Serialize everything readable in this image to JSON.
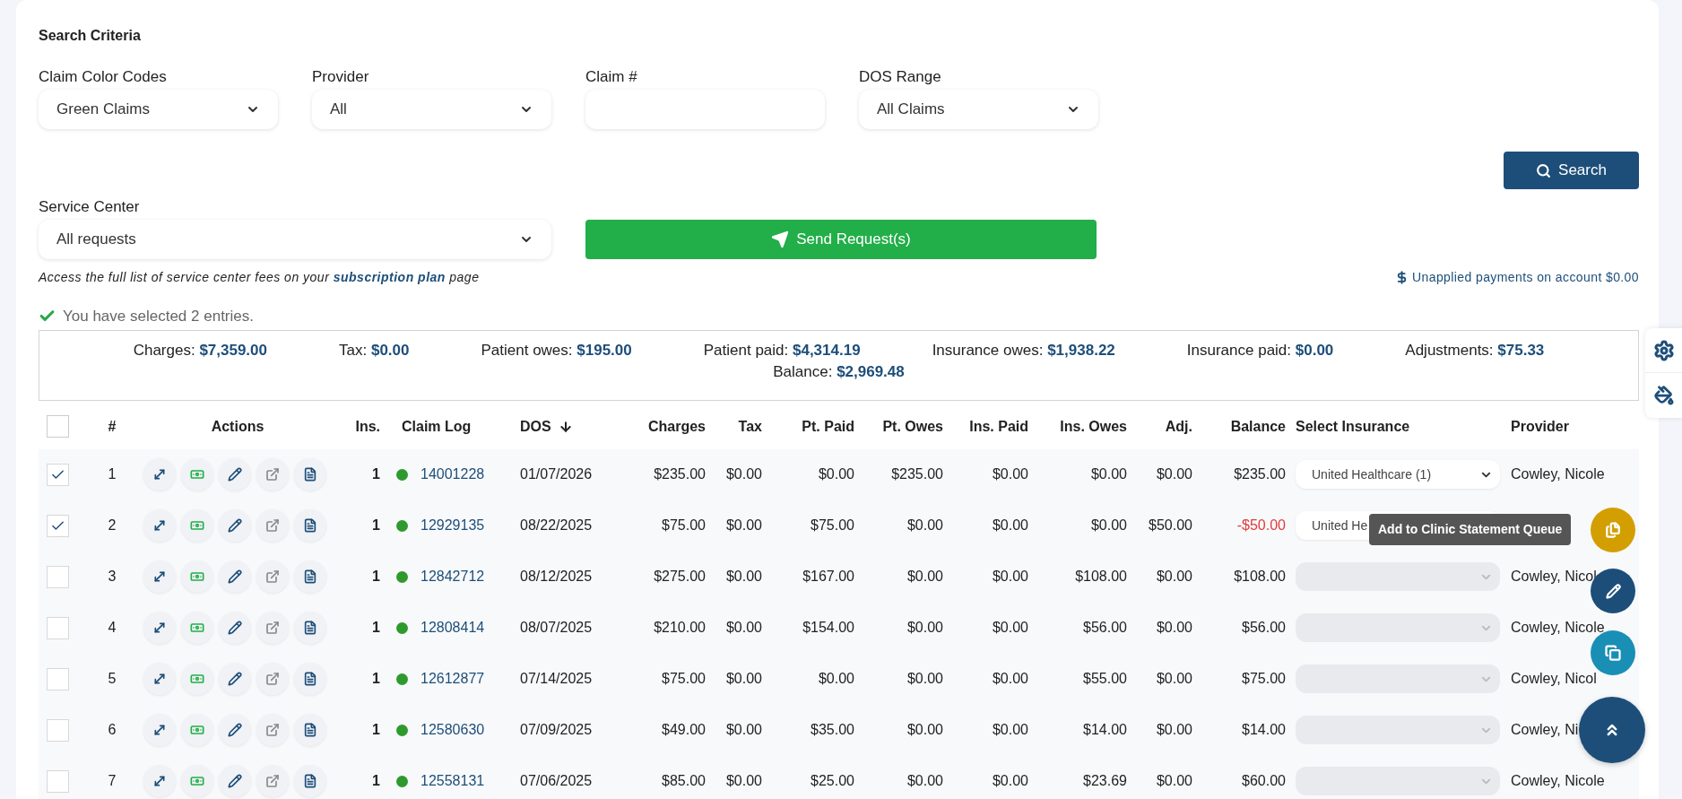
{
  "search_criteria": {
    "title": "Search Criteria",
    "fields": [
      {
        "kind": "select",
        "label": "Claim Color Codes",
        "value": "Green Claims"
      },
      {
        "kind": "select",
        "label": "Provider",
        "value": "All"
      },
      {
        "kind": "input",
        "label": "Claim #"
      },
      {
        "kind": "select",
        "label": "DOS Range",
        "value": "All Claims"
      }
    ],
    "search_button": "Search",
    "service_center": {
      "label": "Service Center",
      "value": "All requests"
    },
    "send_button": "Send Request(s)",
    "note": "Access the full list of service center fees on your **subscription plan** page",
    "unapplied": "Unapplied payments on account $0.00"
  },
  "selection_message": "You have selected 2 entries.",
  "summary": [
    {
      "label": "Charges:",
      "value": "$7,359.00"
    },
    {
      "label": "Tax:",
      "value": "$0.00"
    },
    {
      "label": "Patient owes:",
      "value": "$195.00"
    },
    {
      "label": "Patient paid:",
      "value": "$4,314.19"
    },
    {
      "label": "Insurance owes:",
      "value": "$1,938.22"
    },
    {
      "label": "Insurance paid:",
      "value": "$0.00"
    },
    {
      "label": "Adjustments:",
      "value": "$75.33"
    },
    {
      "label": "Balance:",
      "value": "$2,969.48"
    }
  ],
  "table": {
    "all_checked": false,
    "columns": [
      "#",
      "Actions",
      "Ins.",
      "Claim Log",
      "DOS",
      "Charges",
      "Tax",
      "Pt. Paid",
      "Pt. Owes",
      "Ins. Paid",
      "Ins. Owes",
      "Adj.",
      "Balance",
      "Select Insurance",
      "Provider"
    ],
    "rows": [
      {
        "checked": true,
        "num": "1",
        "ins": "1",
        "color": "#2e9a2e",
        "claim": "14001228",
        "dos": "01/07/2026",
        "charges": "$235.00",
        "tax": "$0.00",
        "pt_paid": "$0.00",
        "pt_owes": "$235.00",
        "ins_paid": "$0.00",
        "ins_owes": "$0.00",
        "adj": "$0.00",
        "balance": "$235.00",
        "negative": false,
        "insurance": {
          "disabled": false,
          "value": "United Healthcare (1)"
        },
        "provider": "Cowley, Nicole"
      },
      {
        "checked": true,
        "num": "2",
        "ins": "1",
        "color": "#2e9a2e",
        "claim": "12929135",
        "dos": "08/22/2025",
        "charges": "$75.00",
        "tax": "$0.00",
        "pt_paid": "$75.00",
        "pt_owes": "$0.00",
        "ins_paid": "$0.00",
        "ins_owes": "$0.00",
        "adj": "$50.00",
        "balance": "-$50.00",
        "negative": true,
        "insurance": {
          "disabled": false,
          "value": "United He",
          "caret": false
        }
      },
      {
        "checked": false,
        "num": "3",
        "ins": "1",
        "color": "#2e9a2e",
        "claim": "12842712",
        "dos": "08/12/2025",
        "charges": "$275.00",
        "tax": "$0.00",
        "pt_paid": "$167.00",
        "pt_owes": "$0.00",
        "ins_paid": "$0.00",
        "ins_owes": "$108.00",
        "adj": "$0.00",
        "balance": "$108.00",
        "negative": false,
        "insurance": {
          "disabled": true
        },
        "provider": "Cowley, Nicol"
      },
      {
        "checked": false,
        "num": "4",
        "ins": "1",
        "color": "#2e9a2e",
        "claim": "12808414",
        "dos": "08/07/2025",
        "charges": "$210.00",
        "tax": "$0.00",
        "pt_paid": "$154.00",
        "pt_owes": "$0.00",
        "ins_paid": "$0.00",
        "ins_owes": "$56.00",
        "adj": "$0.00",
        "balance": "$56.00",
        "negative": false,
        "insurance": {
          "disabled": true
        },
        "provider": "Cowley, Nicole"
      },
      {
        "checked": false,
        "num": "5",
        "ins": "1",
        "color": "#2e9a2e",
        "claim": "12612877",
        "dos": "07/14/2025",
        "charges": "$75.00",
        "tax": "$0.00",
        "pt_paid": "$0.00",
        "pt_owes": "$0.00",
        "ins_paid": "$0.00",
        "ins_owes": "$55.00",
        "adj": "$0.00",
        "balance": "$75.00",
        "negative": false,
        "insurance": {
          "disabled": true
        },
        "provider": "Cowley, Nicol"
      },
      {
        "checked": false,
        "num": "6",
        "ins": "1",
        "color": "#2e9a2e",
        "claim": "12580630",
        "dos": "07/09/2025",
        "charges": "$49.00",
        "tax": "$0.00",
        "pt_paid": "$35.00",
        "pt_owes": "$0.00",
        "ins_paid": "$0.00",
        "ins_owes": "$14.00",
        "adj": "$0.00",
        "balance": "$14.00",
        "negative": false,
        "insurance": {
          "disabled": true
        },
        "provider": "Cowley, Ni"
      },
      {
        "checked": false,
        "num": "7",
        "ins": "1",
        "color": "#2e9a2e",
        "claim": "12558131",
        "dos": "07/06/2025",
        "charges": "$85.00",
        "tax": "$0.00",
        "pt_paid": "$25.00",
        "pt_owes": "$0.00",
        "ins_paid": "$0.00",
        "ins_owes": "$23.69",
        "adj": "$0.00",
        "balance": "$60.00",
        "negative": false,
        "insurance": {
          "disabled": true
        },
        "provider": "Cowley, Nicole"
      }
    ]
  },
  "tooltip": "Add to Clinic Statement Queue"
}
